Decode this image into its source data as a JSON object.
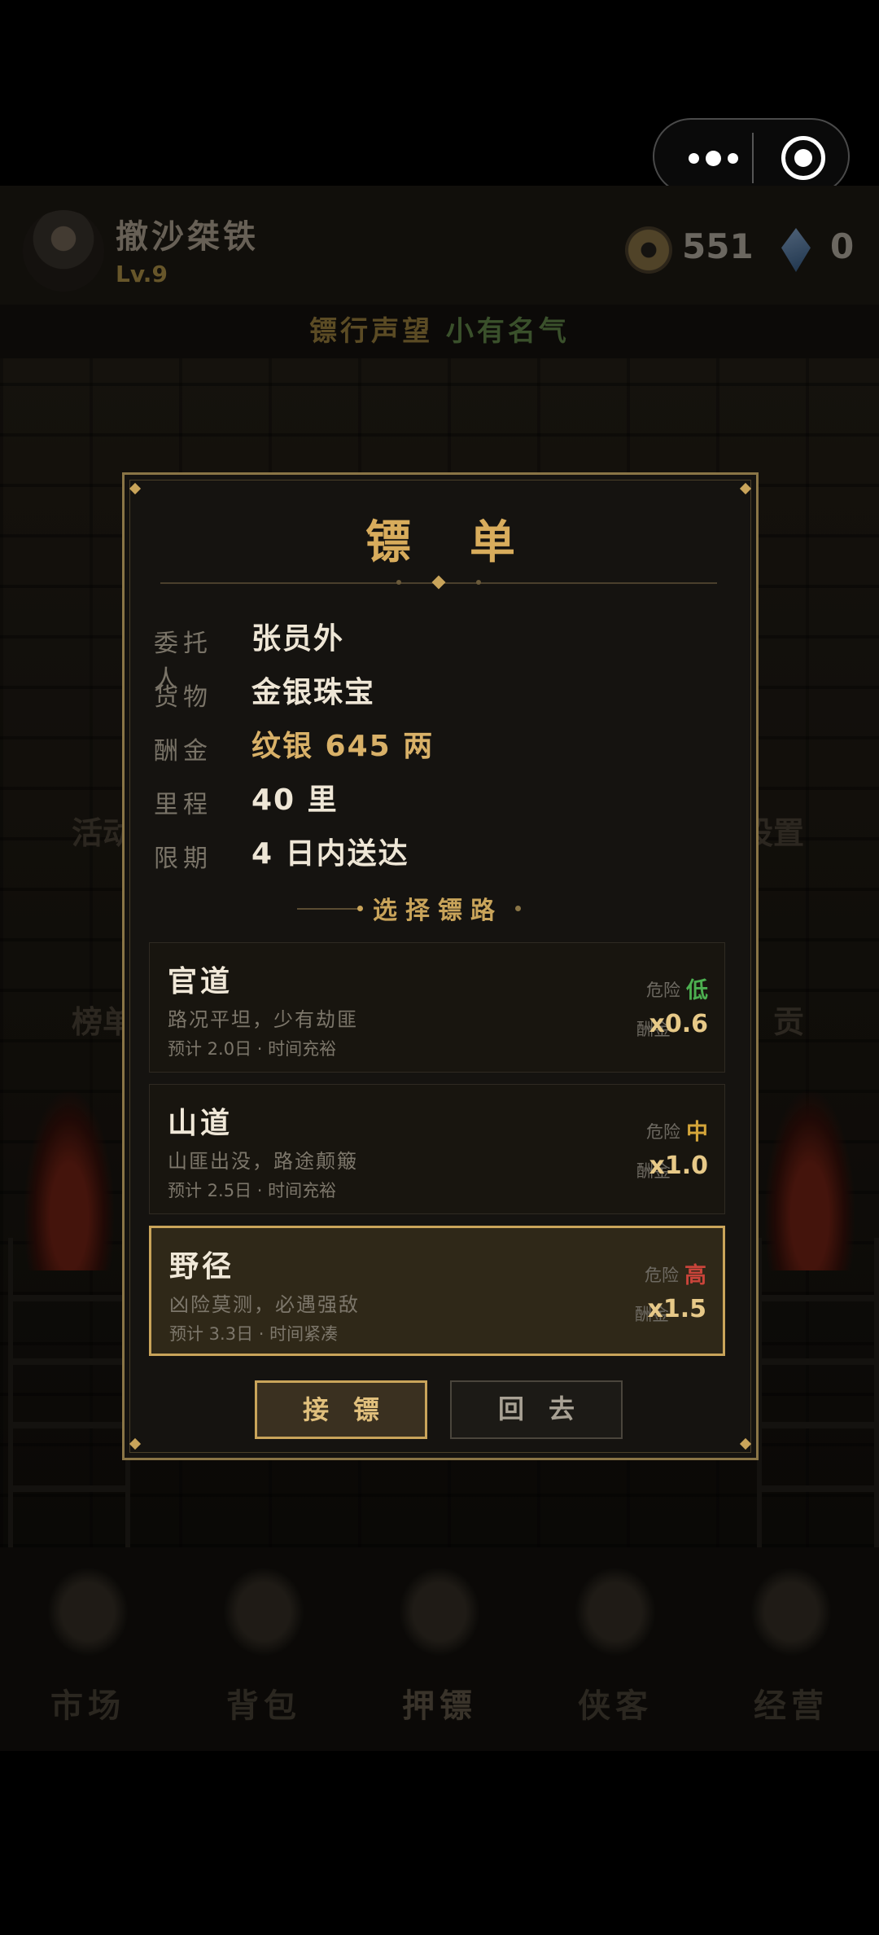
{
  "capsule": {
    "menu_icon": "more-dots-icon",
    "close_icon": "target-icon"
  },
  "player": {
    "name": "撤沙桀铁",
    "level": "Lv.9",
    "coins": "551",
    "gems": "0"
  },
  "reputation": {
    "label": "镖行声望",
    "value": "小有名气"
  },
  "scene_labels": {
    "left1": "活动",
    "left2": "榜单",
    "right1": "设置",
    "right2": "贡"
  },
  "modal": {
    "title": "镖单",
    "fields": [
      {
        "key": "委托人",
        "value": "张员外"
      },
      {
        "key": "货物",
        "value": "金银珠宝"
      },
      {
        "key": "酬金",
        "value": "纹银 645 两"
      },
      {
        "key": "里程",
        "value": "40 里"
      },
      {
        "key": "限期",
        "value": "4 日内送达"
      }
    ],
    "route_header": "选择镖路",
    "routes": [
      {
        "name": "官道",
        "desc": "路况平坦，少有劫匪",
        "eta": "预计 2.0日 · 时间充裕",
        "danger_label": "危险",
        "danger": "低",
        "danger_color": "#4caf50",
        "reward_label": "酬金",
        "reward": "x0.6",
        "selected": false
      },
      {
        "name": "山道",
        "desc": "山匪出没，路途颠簸",
        "eta": "预计 2.5日 · 时间充裕",
        "danger_label": "危险",
        "danger": "中",
        "danger_color": "#d4a53a",
        "reward_label": "酬金",
        "reward": "x1.0",
        "selected": false
      },
      {
        "name": "野径",
        "desc": "凶险莫测，必遇强敌",
        "eta": "预计 3.3日 · 时间紧凑",
        "danger_label": "危险",
        "danger": "高",
        "danger_color": "#c9443a",
        "reward_label": "酬金",
        "reward": "x1.5",
        "selected": true
      }
    ],
    "accept_label": "接镖",
    "back_label": "回去"
  },
  "nav": [
    {
      "label": "市场",
      "icon": "market-icon"
    },
    {
      "label": "背包",
      "icon": "backpack-icon"
    },
    {
      "label": "押镖",
      "icon": "escort-icon"
    },
    {
      "label": "侠客",
      "icon": "hero-icon"
    },
    {
      "label": "经营",
      "icon": "business-icon"
    }
  ]
}
